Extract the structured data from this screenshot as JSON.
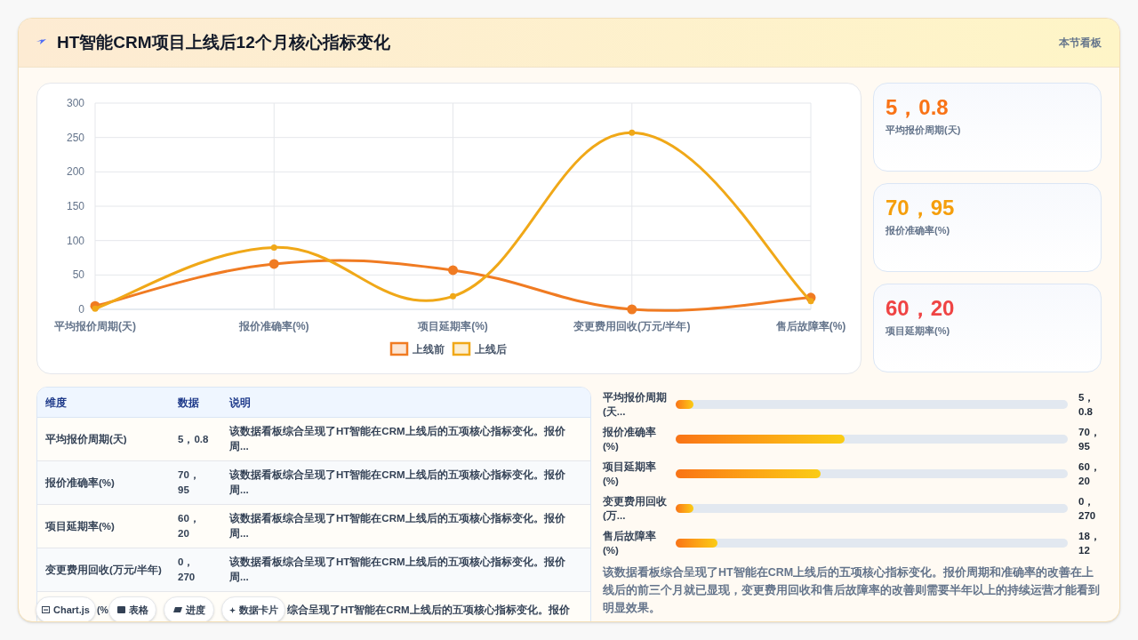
{
  "header": {
    "title": "HT智能CRM项目上线后12个月核心指标变化",
    "badge": "本节看板"
  },
  "chart": {
    "chart_data": {
      "type": "line",
      "grid": true,
      "legend": true,
      "categories": [
        "平均报价周期(天)",
        "报价准确率(%)",
        "项目延期率(%)",
        "变更费用回收(万元/半年)",
        "售后故障率(%)"
      ],
      "ylim": [
        0,
        300
      ],
      "yticks": [
        0,
        50,
        100,
        150,
        200,
        250,
        300
      ],
      "series": [
        {
          "name": "上线前",
          "color": "#f07b22",
          "marker": true,
          "values": [
            5,
            66,
            57,
            0,
            17
          ]
        },
        {
          "name": "上线后",
          "color": "#f0a818",
          "marker": true,
          "values": [
            1,
            90,
            19,
            257,
            12
          ]
        }
      ]
    }
  },
  "kpi_cards": [
    {
      "value": "5，0.8",
      "label": "平均报价周期(天)",
      "color": "#f97316"
    },
    {
      "value": "70，95",
      "label": "报价准确率(%)",
      "color": "#f59e0b"
    },
    {
      "value": "60，20",
      "label": "项目延期率(%)",
      "color": "#ef4444"
    }
  ],
  "table": {
    "columns": [
      "维度",
      "数据",
      "说明"
    ],
    "rows": [
      {
        "cells": [
          "平均报价周期(天)",
          "5，0.8",
          "该数据看板综合呈现了HT智能在CRM上线后的五项核心指标变化。报价周..."
        ]
      },
      {
        "cells": [
          "报价准确率(%)",
          "70，95",
          "该数据看板综合呈现了HT智能在CRM上线后的五项核心指标变化。报价周..."
        ]
      },
      {
        "cells": [
          "项目延期率(%)",
          "60，20",
          "该数据看板综合呈现了HT智能在CRM上线后的五项核心指标变化。报价周..."
        ]
      },
      {
        "cells": [
          "变更费用回收(万元/半年)",
          "0，270",
          "该数据看板综合呈现了HT智能在CRM上线后的五项核心指标变化。报价周..."
        ]
      },
      {
        "cells": [
          "(%",
          "",
          "综合呈现了HT智能在CRM上线后的五项核心指标变化。报价"
        ]
      }
    ]
  },
  "progress": [
    {
      "label": "平均报价周期(天...",
      "value": "5，0.8",
      "level": 0.045
    },
    {
      "label": "报价准确率(%)",
      "value": "70，95",
      "level": 0.43
    },
    {
      "label": "项目延期率(%)",
      "value": "60，20",
      "level": 0.37
    },
    {
      "label": "变更费用回收(万...",
      "value": "0，270",
      "level": 0.045
    },
    {
      "label": "售后故障率(%)",
      "value": "18，12",
      "level": 0.107
    }
  ],
  "summary": "该数据看板综合呈现了HT智能在CRM上线后的五项核心指标变化。报价周期和准确率的改善在上线后的前三个月就已显现，变更费用回收和售后故障率的改善则需要半年以上的持续运营才能看到明显效果。",
  "view_pills": [
    {
      "kind": "chart",
      "label": "Chart.js"
    },
    {
      "kind": "table",
      "label": "表格"
    },
    {
      "kind": "progress",
      "label": "进度"
    },
    {
      "kind": "cards",
      "label": "数据卡片"
    }
  ]
}
